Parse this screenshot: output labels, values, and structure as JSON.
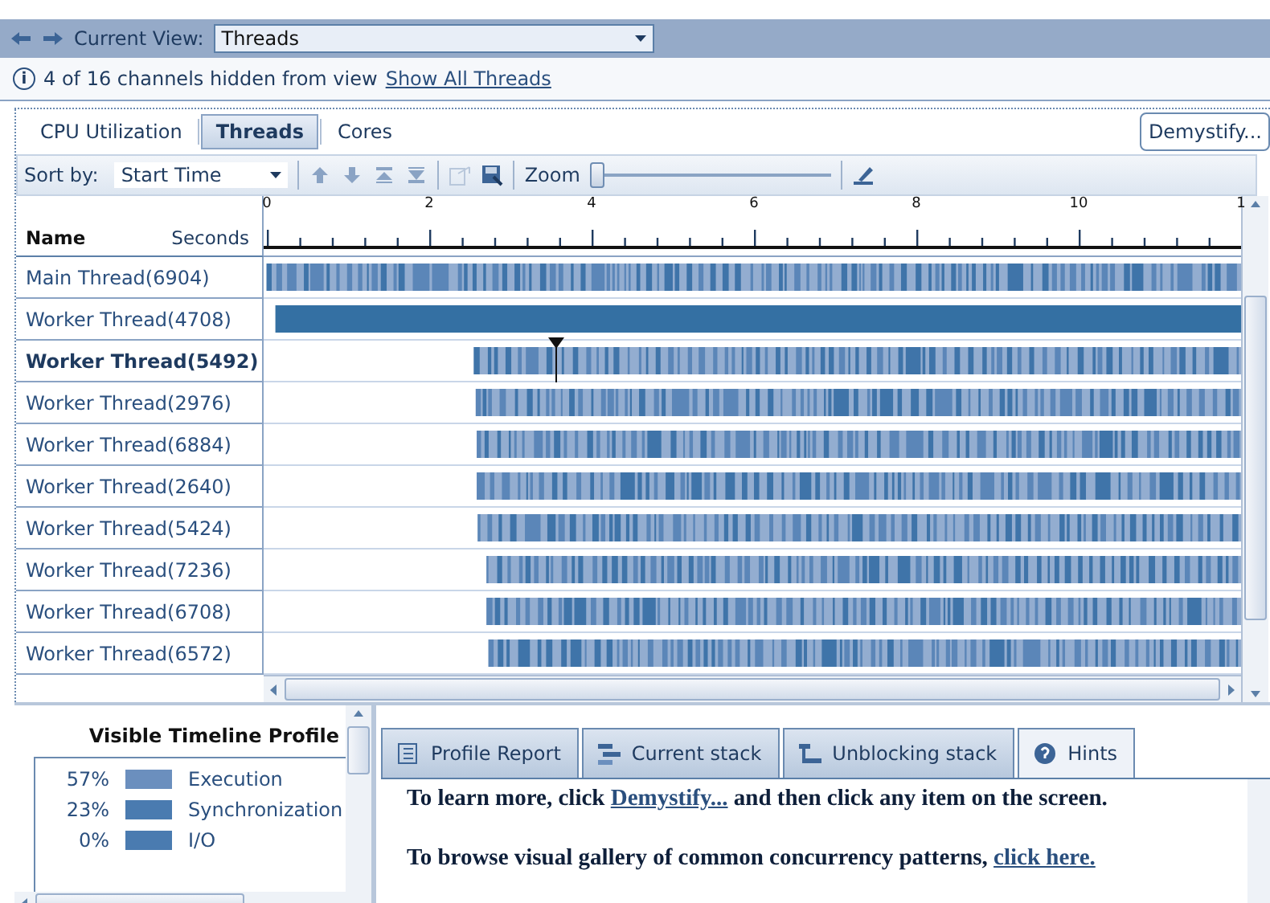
{
  "nav": {
    "label": "Current View:",
    "view": "Threads"
  },
  "info": {
    "icon": "i",
    "message": "4 of 16  channels hidden from view",
    "link": "Show All Threads"
  },
  "tabs": [
    {
      "label": "CPU Utilization",
      "selected": false
    },
    {
      "label": "Threads",
      "selected": true
    },
    {
      "label": "Cores",
      "selected": false
    }
  ],
  "demystify_button": "Demystify...",
  "toolbar": {
    "sort_label": "Sort by:",
    "sort_value": "Start Time",
    "zoom_label": "Zoom",
    "zoom": {
      "level": 0.0
    }
  },
  "timeline": {
    "name_header": "Name",
    "seconds_header": "Seconds",
    "ticks": [
      "0",
      "2",
      "4",
      "6",
      "8",
      "10",
      "1"
    ],
    "rows": [
      {
        "name": "Main Thread(6904)",
        "selected": false,
        "kind": "striped"
      },
      {
        "name": "Worker Thread(4708)",
        "selected": false,
        "kind": "solid"
      },
      {
        "name": "Worker Thread(5492)",
        "selected": true,
        "kind": "striped"
      },
      {
        "name": "Worker Thread(2976)",
        "selected": false,
        "kind": "striped"
      },
      {
        "name": "Worker Thread(6884)",
        "selected": false,
        "kind": "striped"
      },
      {
        "name": "Worker Thread(2640)",
        "selected": false,
        "kind": "striped"
      },
      {
        "name": "Worker Thread(5424)",
        "selected": false,
        "kind": "striped"
      },
      {
        "name": "Worker Thread(7236)",
        "selected": false,
        "kind": "striped"
      },
      {
        "name": "Worker Thread(6708)",
        "selected": false,
        "kind": "striped"
      },
      {
        "name": "Worker Thread(6572)",
        "selected": false,
        "kind": "striped"
      }
    ]
  },
  "profile": {
    "title": "Visible Timeline Profile",
    "items": [
      {
        "percent": "57%",
        "label": "Execution",
        "color": "#6b8fbe"
      },
      {
        "percent": "23%",
        "label": "Synchronization",
        "color": "#4a7bb0"
      },
      {
        "percent": "0%",
        "label": "I/O",
        "color": "#4a7bb0"
      }
    ]
  },
  "report_tabs": [
    {
      "label": "Profile Report",
      "selected": false
    },
    {
      "label": "Current stack",
      "selected": false
    },
    {
      "label": "Unblocking stack",
      "selected": false
    },
    {
      "label": "Hints",
      "selected": true
    }
  ],
  "hints": [
    {
      "text": "To learn more, click ",
      "link": "Demystify...",
      "after": " and then click any item on the screen."
    },
    {
      "text": "To browse visual gallery of common concurrency patterns, ",
      "link": "click here."
    }
  ]
}
